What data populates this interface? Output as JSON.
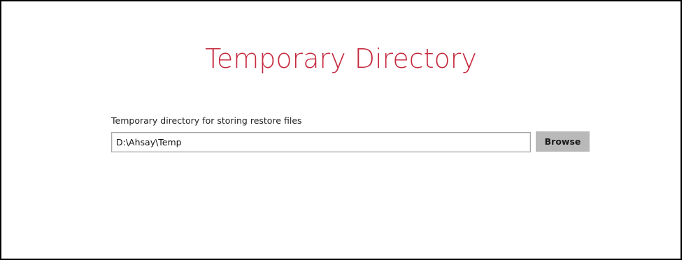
{
  "page": {
    "title": "Temporary Directory"
  },
  "directory": {
    "label": "Temporary directory for storing restore files",
    "value": "D:\\Ahsay\\Temp",
    "browse_label": "Browse"
  },
  "colors": {
    "title": "#c52a3e",
    "button_bg": "#b9b9b9"
  }
}
